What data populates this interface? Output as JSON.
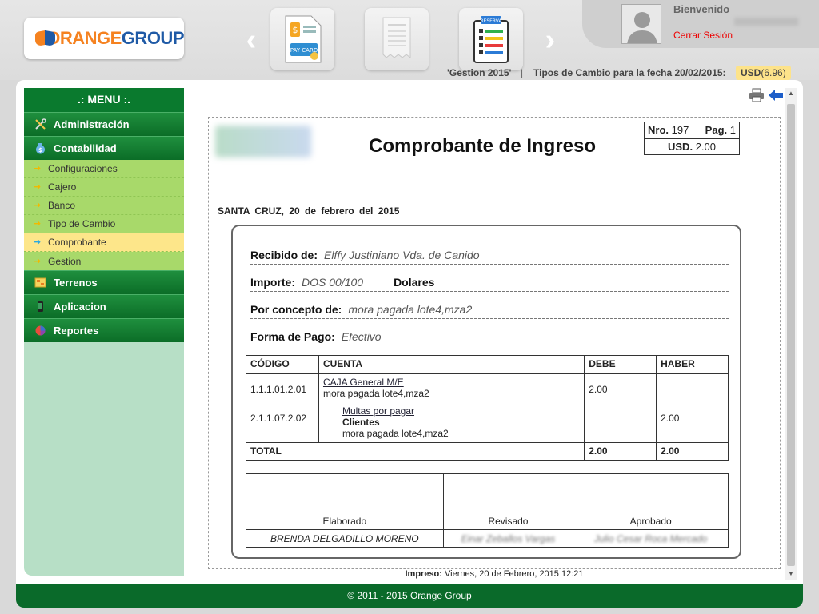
{
  "brand": {
    "name_orange": "ORANGE",
    "name_group": "GROUP"
  },
  "header": {
    "welcome": "Bienvenido",
    "logout": "Cerrar Sesión",
    "gestion": "'Gestion 2015'",
    "separator": "|",
    "exchange_label": "Tipos de Cambio para la fecha 20/02/2015:",
    "usd_code": "USD",
    "usd_value": "(6.96)",
    "prev_arrow": "‹",
    "next_arrow": "›",
    "tile_paycard": "PAY CARD",
    "tile_reserva": "RESERVA"
  },
  "menu": {
    "title": ".: MENU :.",
    "sections": {
      "administracion": "Administración",
      "contabilidad": "Contabilidad",
      "terrenos": "Terrenos",
      "aplicacion": "Aplicacion",
      "reportes": "Reportes"
    },
    "contabilidad_items": [
      "Configuraciones",
      "Cajero",
      "Banco",
      "Tipo de Cambio",
      "Comprobante",
      "Gestion"
    ],
    "active_item": "Comprobante"
  },
  "document": {
    "title": "Comprobante de Ingreso",
    "nro_label": "Nro.",
    "nro_value": "197",
    "pag_label": "Pag.",
    "pag_value": "1",
    "currency_label": "USD.",
    "currency_value": "2.00",
    "city_date": "SANTA CRUZ, 20 de febrero del 2015",
    "recibido_label": "Recibido de:",
    "recibido_value": "Elffy Justiniano Vda. de Canido",
    "importe_label": "Importe:",
    "importe_value": "DOS 00/100",
    "importe_currency": "Dolares",
    "concepto_label": "Por concepto de:",
    "concepto_value": "mora pagada lote4,mza2",
    "forma_label": "Forma de Pago:",
    "forma_value": "Efectivo",
    "table": {
      "headers": [
        "CÓDIGO",
        "CUENTA",
        "DEBE",
        "HABER"
      ],
      "codes": [
        "1.1.1.01.2.01",
        "2.1.1.07.2.02"
      ],
      "account1_name": "CAJA General M/E",
      "account1_desc": "mora pagada lote4,mza2",
      "account2_parent": "Multas por pagar",
      "account2_name": "Clientes",
      "account2_desc": "mora pagada lote4,mza2",
      "debe": "2.00",
      "haber": "2.00",
      "total_label": "TOTAL",
      "total_debe": "2.00",
      "total_haber": "2.00"
    },
    "signatures": {
      "elaborado": "Elaborado",
      "revisado": "Revisado",
      "aprobado": "Aprobado",
      "elaborado_name": "BRENDA DELGADILLO MORENO",
      "revisado_name": "Einar Zeballos Vargas",
      "aprobado_name": "Julio Cesar Roca Mercado"
    },
    "printed_label": "Impreso:",
    "printed_value": "Viernes, 20 de Febrero, 2015 12:21"
  },
  "footer": {
    "text": "© 2011 - 2015 Orange Group"
  },
  "colors": {
    "menu_green": "#0a7a2e",
    "submenu_green": "#a8d96a",
    "active_yellow": "#fde68a",
    "brand_orange": "#f58220",
    "brand_blue": "#1f5aa6",
    "logout_red": "#ee0000"
  }
}
